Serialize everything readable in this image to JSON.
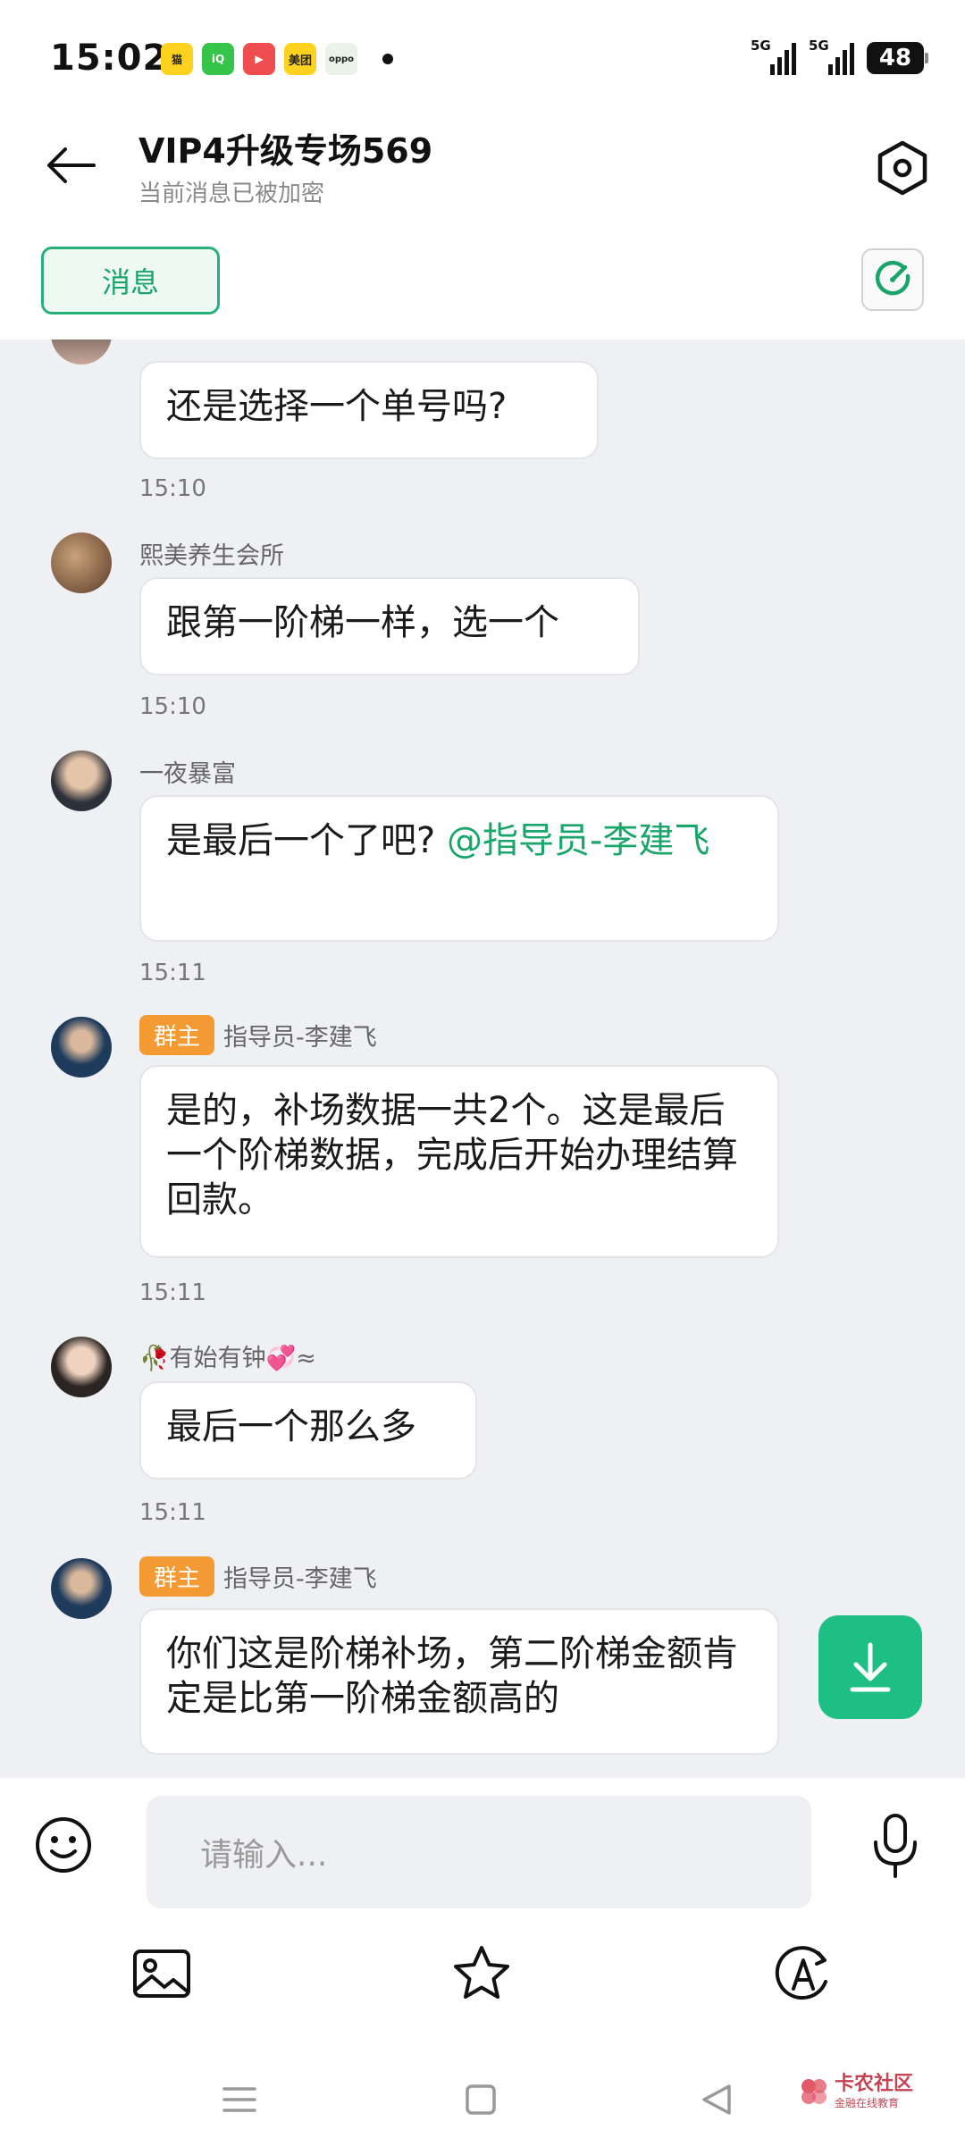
{
  "status_bar": {
    "time": "15:02",
    "apps": [
      {
        "name": "tmall-app-icon",
        "label": "猫",
        "color": "#ffd21f"
      },
      {
        "name": "iqiyi-app-icon",
        "label": "iQ",
        "color": "#36c44a"
      },
      {
        "name": "video-app-icon",
        "label": "▶",
        "color": "#f04e4e"
      },
      {
        "name": "meituan-app-icon",
        "label": "美团",
        "color": "#ffd21f"
      },
      {
        "name": "oppo-app-icon",
        "label": "oppo",
        "color": "#e9f3ea"
      }
    ],
    "network_1": "5G",
    "network_2": "5G",
    "battery": "48"
  },
  "header": {
    "title": "VIP4升级专场569",
    "subtitle": "当前消息已被加密",
    "tab_label": "消息"
  },
  "messages": [
    {
      "bubble": "还是选择一个单号吗?",
      "time": "15:10"
    },
    {
      "sender": "熙美养生会所",
      "bubble": "跟第一阶梯一样，选一个",
      "time": "15:10"
    },
    {
      "sender": "一夜暴富",
      "bubble_text": "是最后一个了吧? ",
      "bubble_mention": "@指导员-李建飞",
      "time": "15:11"
    },
    {
      "badge": "群主",
      "sender": "指导员-李建飞",
      "bubble": "是的，补场数据一共2个。这是最后一个阶梯数据，完成后开始办理结算回款。",
      "time": "15:11"
    },
    {
      "sender": "🥀有始有钟💞≈",
      "bubble": "最后一个那么多",
      "time": "15:11"
    },
    {
      "badge": "群主",
      "sender": "指导员-李建飞",
      "bubble": "你们这是阶梯补场，第二阶梯金额肯定是比第一阶梯金额高的"
    }
  ],
  "input": {
    "placeholder": "请输入..."
  },
  "watermark": {
    "main": "卡农社区",
    "sub": "金融在线教育"
  }
}
